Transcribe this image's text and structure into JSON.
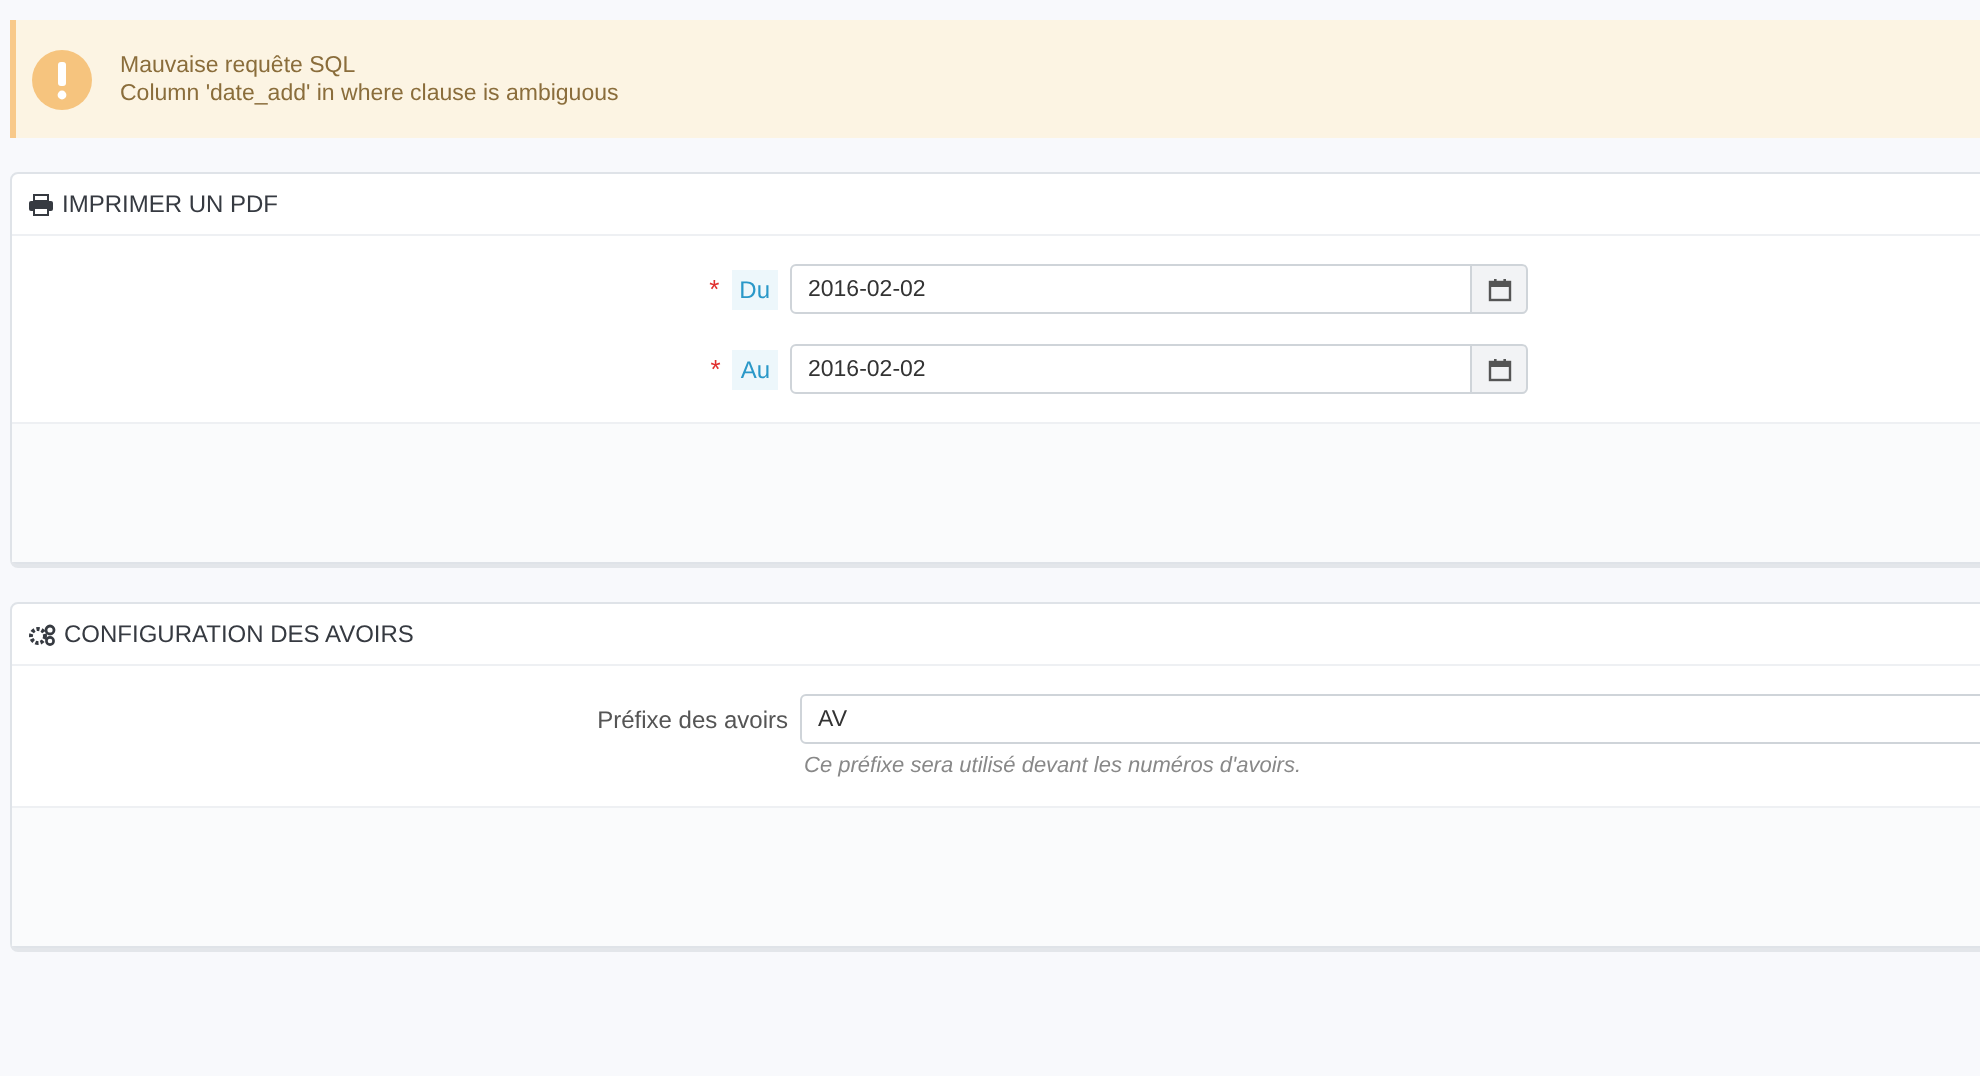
{
  "alert": {
    "title": "Mauvaise requête SQL",
    "message": "Column 'date_add' in where clause is ambiguous"
  },
  "panels": [
    {
      "title": "IMPRIMER UN PDF",
      "fields": [
        {
          "kind": "date",
          "required_mark": "*",
          "label": "Du",
          "value": "2016-02-02"
        },
        {
          "kind": "date",
          "required_mark": "*",
          "label": "Au",
          "value": "2016-02-02"
        }
      ]
    },
    {
      "title": "CONFIGURATION DES AVOIRS",
      "fields": [
        {
          "kind": "text",
          "label": "Préfixe des avoirs",
          "value": "AV",
          "help": "Ce préfixe sera utilisé devant les numéros d'avoirs."
        }
      ]
    }
  ]
}
